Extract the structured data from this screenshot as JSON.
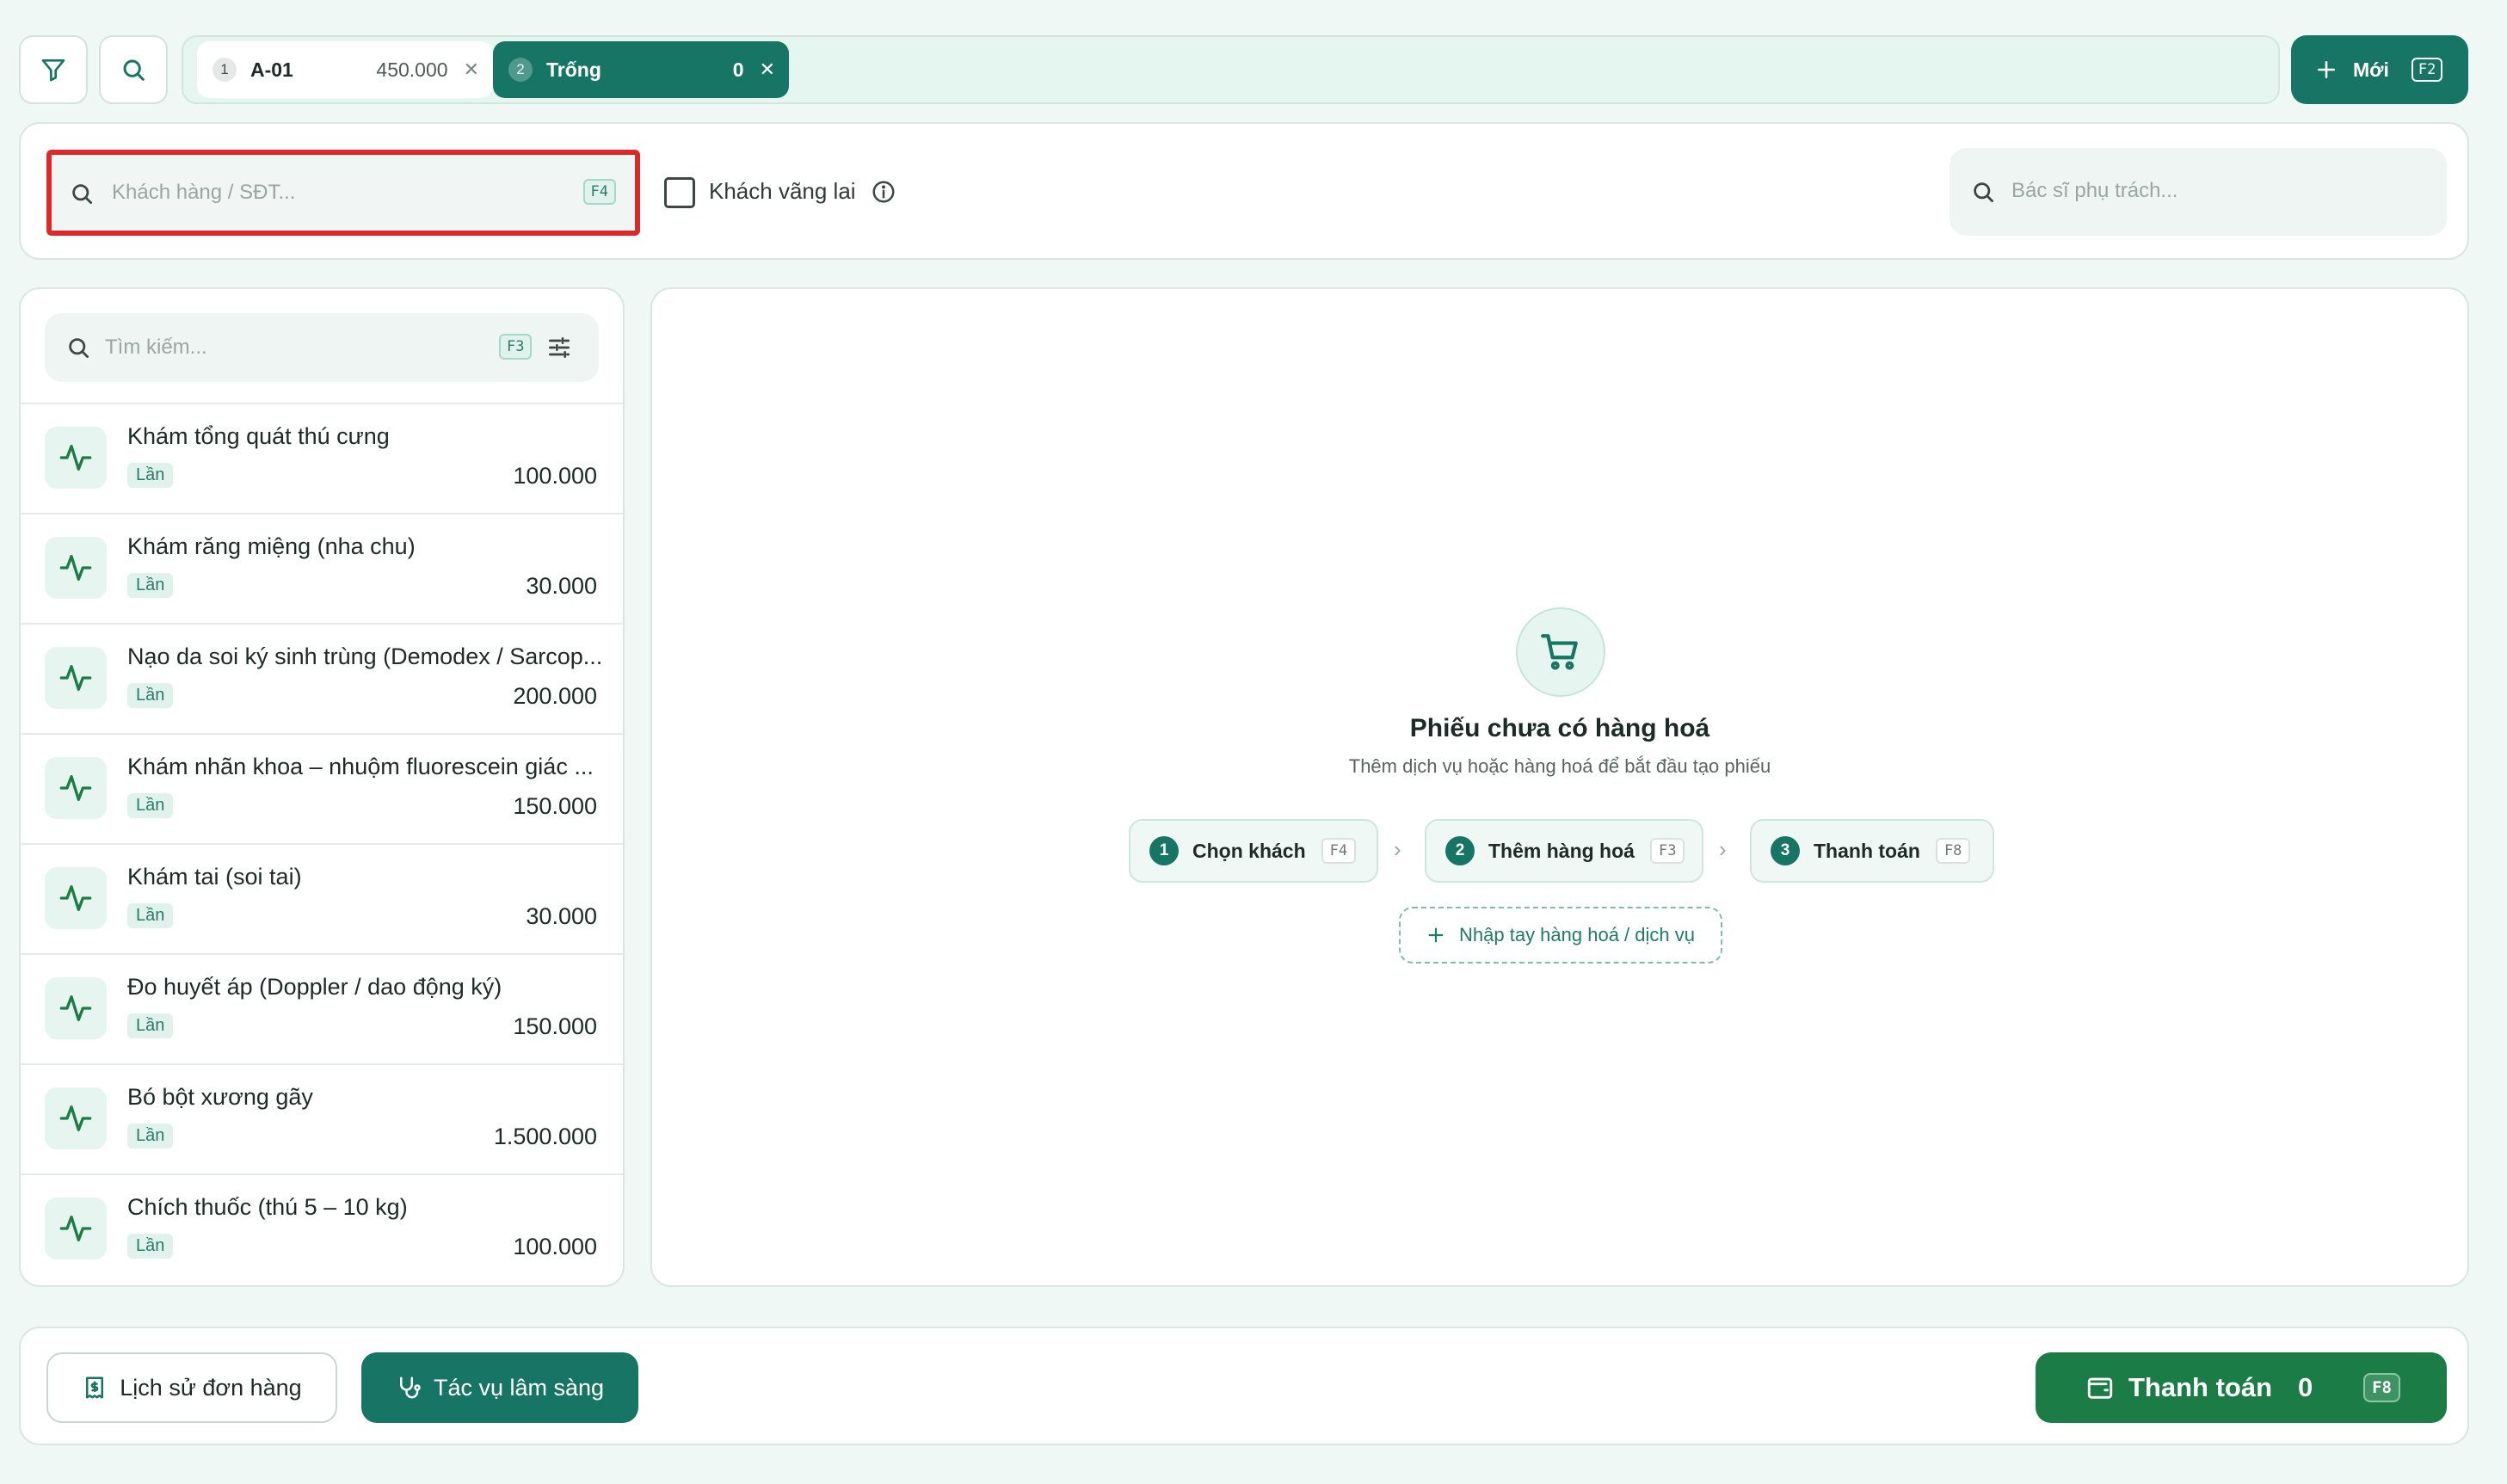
{
  "tabs": [
    {
      "number": "1",
      "name": "A-01",
      "amount": "450.000",
      "active": false
    },
    {
      "number": "2",
      "name": "Trống",
      "amount": "0",
      "active": true
    }
  ],
  "new_button": {
    "label": "Mới",
    "shortcut": "F2"
  },
  "customer": {
    "placeholder": "Khách hàng / SĐT...",
    "shortcut": "F4",
    "walkin_label": "Khách vãng lai",
    "doctor_placeholder": "Bác sĩ phụ trách..."
  },
  "catalog": {
    "search_placeholder": "Tìm kiếm...",
    "search_shortcut": "F3",
    "items": [
      {
        "name": "Khám tổng quát thú cưng",
        "unit": "Lần",
        "price": "100.000"
      },
      {
        "name": "Khám răng miệng (nha chu)",
        "unit": "Lần",
        "price": "30.000"
      },
      {
        "name": "Nạo da soi ký sinh trùng (Demodex / Sarcop...",
        "unit": "Lần",
        "price": "200.000"
      },
      {
        "name": "Khám nhãn khoa – nhuộm fluorescein giác ...",
        "unit": "Lần",
        "price": "150.000"
      },
      {
        "name": "Khám tai (soi tai)",
        "unit": "Lần",
        "price": "30.000"
      },
      {
        "name": "Đo huyết áp (Doppler / dao động ký)",
        "unit": "Lần",
        "price": "150.000"
      },
      {
        "name": "Bó bột xương gãy",
        "unit": "Lần",
        "price": "1.500.000"
      },
      {
        "name": "Chích thuốc (thú 5 – 10 kg)",
        "unit": "Lần",
        "price": "100.000"
      }
    ]
  },
  "cart": {
    "empty_title": "Phiếu chưa có hàng hoá",
    "empty_subtitle": "Thêm dịch vụ hoặc hàng hoá để bắt đầu tạo phiếu",
    "steps": [
      {
        "number": "1",
        "label": "Chọn khách",
        "shortcut": "F4"
      },
      {
        "number": "2",
        "label": "Thêm hàng hoá",
        "shortcut": "F3"
      },
      {
        "number": "3",
        "label": "Thanh toán",
        "shortcut": "F8"
      }
    ],
    "manual_button": "Nhập tay hàng hoá / dịch vụ"
  },
  "bottom": {
    "history_label": "Lịch sử đơn hàng",
    "clinical_label": "Tác vụ lâm sàng",
    "pay_label": "Thanh toán",
    "pay_amount": "0",
    "pay_shortcut": "F8"
  },
  "colors": {
    "primary": "#177566",
    "pay_green": "#1b7d45",
    "highlight_red": "#dc2a2a",
    "background": "#f0f8f5"
  },
  "icons": {
    "filter": "filter-icon",
    "search": "search-icon",
    "plus": "plus-icon",
    "info": "info-icon",
    "sliders": "sliders-icon",
    "activity": "activity-icon",
    "cart": "shopping-cart-icon",
    "receipt": "receipt-icon",
    "stethoscope": "stethoscope-icon",
    "wallet": "wallet-icon"
  }
}
